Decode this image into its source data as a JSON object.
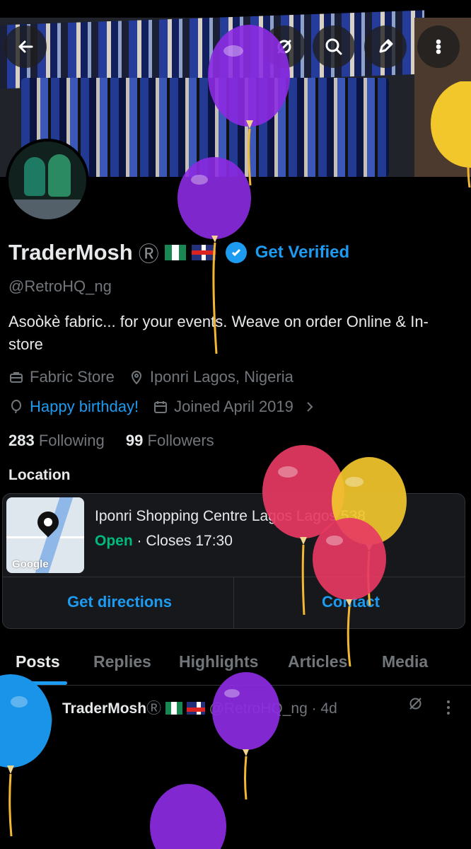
{
  "profile": {
    "name": "TraderMosh",
    "registered_symbol": "Ⓡ",
    "get_verified_label": "Get Verified",
    "handle": "@RetroHQ_ng",
    "bio": "Asoòkè fabric... for your events.  Weave on order Online & In-store",
    "category": "Fabric Store",
    "location": "Iponri Lagos, Nigeria",
    "birthday_label": "Happy birthday!",
    "joined": "Joined April 2019",
    "following_count": "283",
    "following_label": "Following",
    "followers_count": "99",
    "followers_label": "Followers"
  },
  "location_section": {
    "heading": "Location",
    "place_name": "Iponri Shopping Centre Lagos Lagos 538",
    "status_open": "Open",
    "status_close": " · Closes 17:30",
    "map_label": "Google",
    "directions_label": "Get directions",
    "contact_label": "Contact"
  },
  "tabs": [
    {
      "label": "Posts"
    },
    {
      "label": "Replies"
    },
    {
      "label": "Highlights"
    },
    {
      "label": "Articles"
    },
    {
      "label": "Media"
    }
  ],
  "post": {
    "author": "TraderMosh",
    "registered_symbol": "Ⓡ",
    "handle_time": "@RetroHQ_ng · 4d"
  },
  "colors": {
    "accent": "#1d9bf0",
    "open_status": "#00ba7c",
    "balloon_purple": "#8c2be2",
    "balloon_red": "#e73a62",
    "balloon_yellow": "#f2c72c",
    "balloon_blue": "#1a94e8"
  },
  "icons": {
    "back": "back-arrow-icon",
    "grok": "grok-icon",
    "search": "search-icon",
    "edit": "edit-pencil-icon",
    "more": "more-vertical-icon",
    "category": "briefcase-icon",
    "location": "map-pin-icon",
    "birthday": "balloon-icon",
    "joined": "calendar-icon",
    "chevron": "chevron-right-icon"
  }
}
